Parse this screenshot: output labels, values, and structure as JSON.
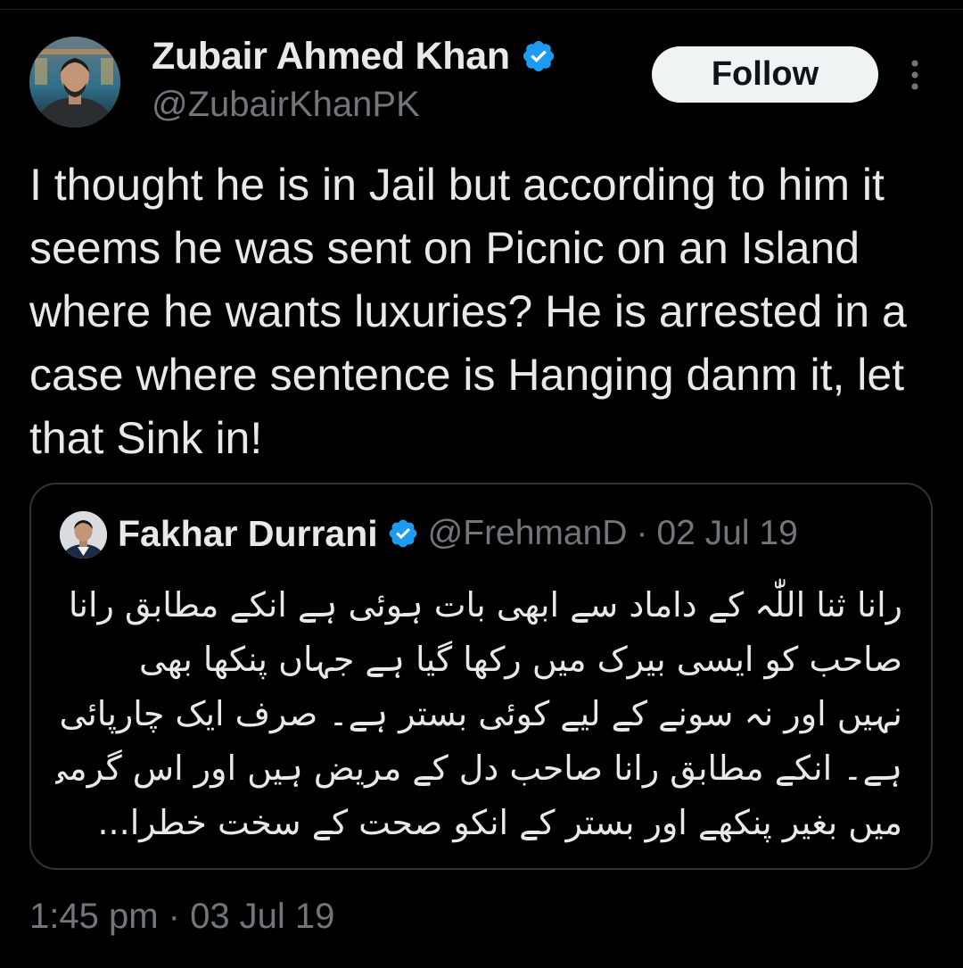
{
  "tweet": {
    "author": {
      "name": "Zubair Ahmed Khan",
      "handle": "@ZubairKhanPK",
      "verified_color": "#1d9bf0"
    },
    "follow_label": "Follow",
    "more_icon": "more-vertical-icon",
    "text": "I thought he is in Jail but according to him it seems he was sent on Picnic on an Island where he wants luxuries? He is arrested in a case where sentence is Hanging danm it, let that Sink in!",
    "quote": {
      "author": {
        "name": "Fakhar Durrani",
        "handle": "@FrehmanD",
        "separator": "·",
        "date": "02 Jul 19"
      },
      "lines": [
        "رانا ثنا اللّٰہ کے داماد سے ابھی بات ہوئی ہے انکے مطابق رانا",
        "صاحب کو ایسی بیرک میں رکھا گیا ہے جہاں پنکھا بھی",
        "نہیں اور نہ سونے کے لیے کوئی بستر ہے۔ صرف ایک چارپائی",
        "ہے۔ انکے مطابق رانا صاحب دل کے مریض ہیں اور اس گرمی",
        "میں بغیر پنکھے اور بستر کے انکو صحت کے سخت خطرا..."
      ]
    },
    "timestamp": "1:45 pm · 03 Jul 19"
  },
  "colors": {
    "background": "#000000",
    "text_primary": "#e7e9ea",
    "text_secondary": "#71767b",
    "border": "#2f3336",
    "button_bg": "#eff3f4",
    "button_text": "#0f1419",
    "verified": "#1d9bf0"
  }
}
